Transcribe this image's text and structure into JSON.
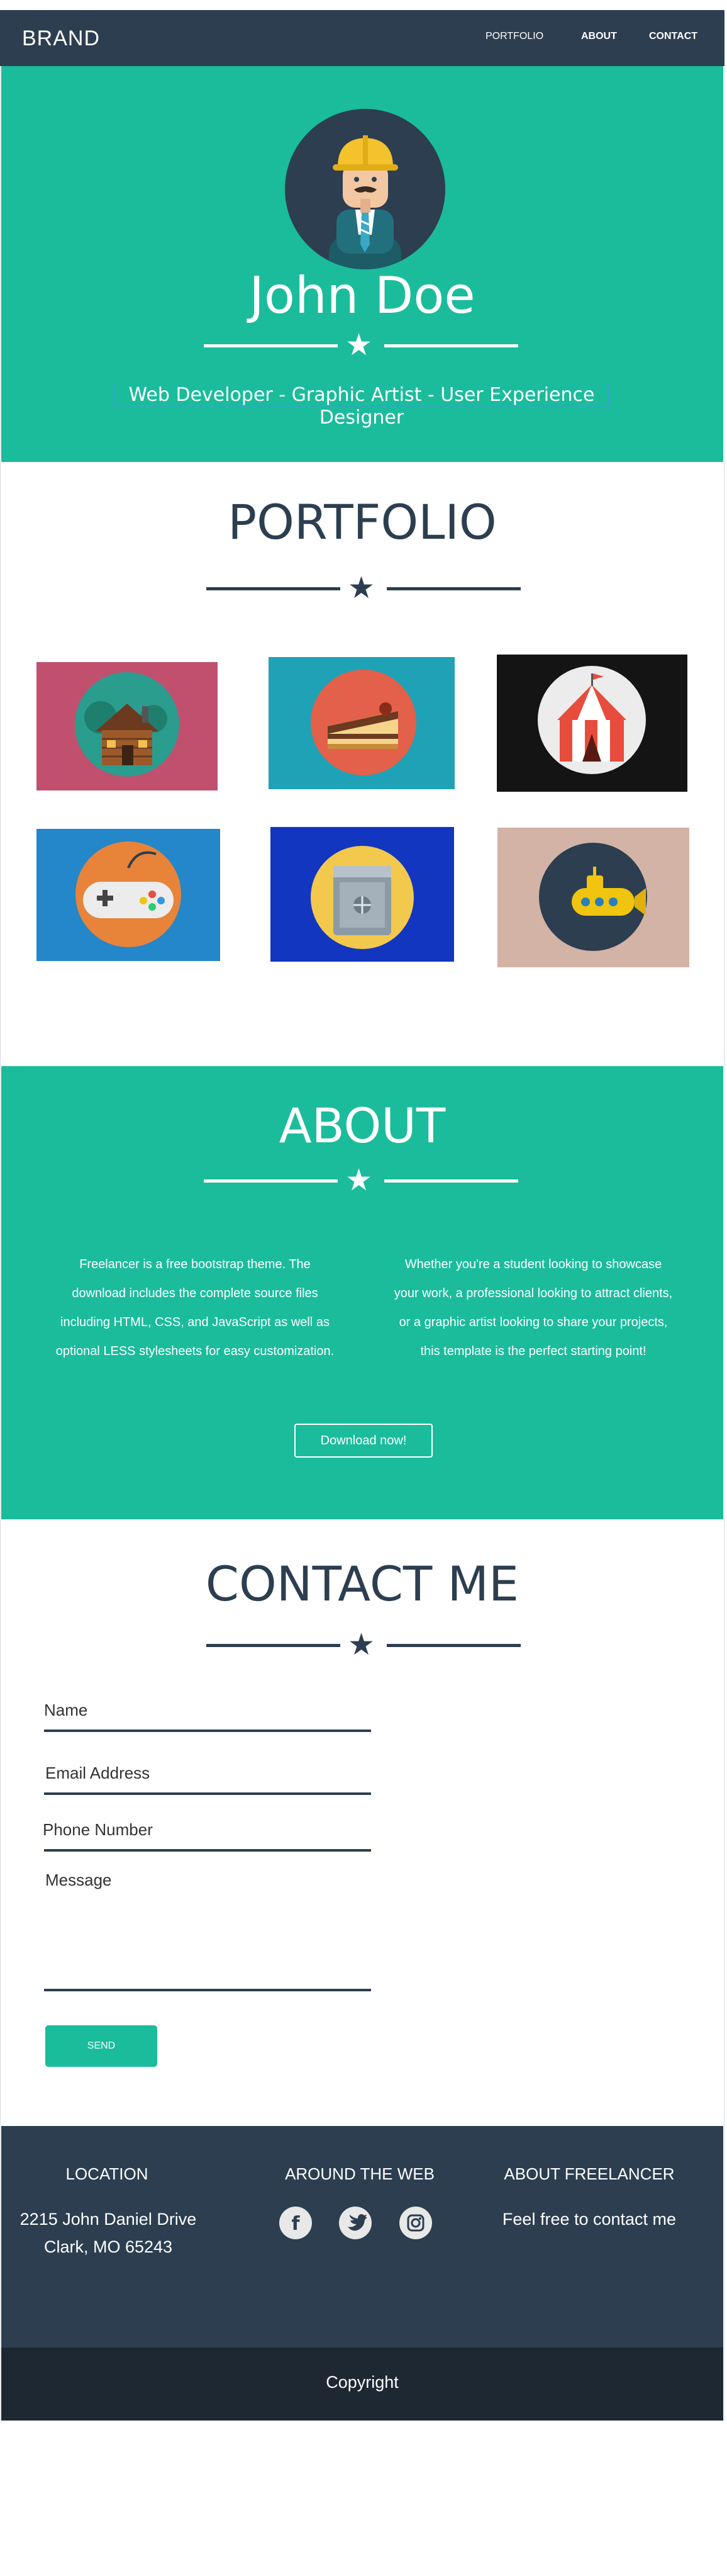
{
  "nav": {
    "brand": "BRAND",
    "links": [
      "PORTFOLIO",
      "ABOUT",
      "CONTACT"
    ]
  },
  "hero": {
    "name": "John Doe",
    "subtitle": "Web Developer - Graphic Artist - User Experience Designer",
    "avatar_icon": "developer-avatar-icon"
  },
  "portfolio": {
    "title": "PORTFOLIO",
    "items": [
      {
        "icon": "cabin-icon",
        "bg": "#c0506e"
      },
      {
        "icon": "cake-icon",
        "bg": "#1fa2b6"
      },
      {
        "icon": "circus-tent-icon",
        "bg": "#141414"
      },
      {
        "icon": "game-controller-icon",
        "bg": "#2387c9"
      },
      {
        "icon": "safe-icon",
        "bg": "#1336c0"
      },
      {
        "icon": "submarine-icon",
        "bg": "#d2b3a6"
      }
    ]
  },
  "about": {
    "title": "ABOUT",
    "left_text": "Freelancer is a free bootstrap theme. The download includes the complete source files including HTML, CSS, and JavaScript as well as optional LESS stylesheets for easy customization.",
    "right_text": "Whether you're a student looking to showcase your work, a professional looking to attract clients, or a graphic artist looking to share your projects, this template is the perfect starting point!",
    "button": "Download now!"
  },
  "contact": {
    "title": "CONTACT ME",
    "fields": {
      "name": "Name",
      "email": "Email Address",
      "phone": "Phone Number",
      "message": "Message"
    },
    "send": "SEND"
  },
  "footer": {
    "location_heading": "LOCATION",
    "address_line1": "2215 John Daniel Drive",
    "address_line2": "Clark, MO 65243",
    "web_heading": "AROUND THE WEB",
    "social": [
      "facebook-icon",
      "twitter-icon",
      "instagram-icon"
    ],
    "about_heading": "ABOUT FREELANCER",
    "about_text": "Feel free to contact me",
    "copyright": "Copyright"
  },
  "colors": {
    "primary": "#2c3e50",
    "accent": "#1abc9c",
    "footer_bottom": "#1e2833"
  }
}
